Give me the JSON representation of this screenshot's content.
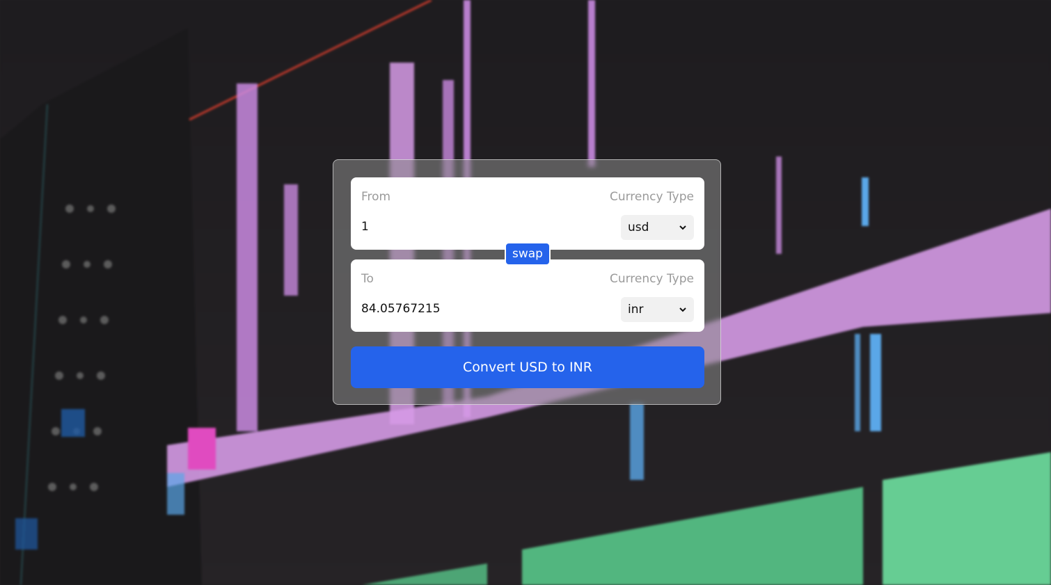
{
  "background": {
    "description_icon": "video-editor-timeline-photo"
  },
  "converter": {
    "from": {
      "label": "From",
      "currency_label": "Currency Type",
      "amount": "1",
      "currency": "usd"
    },
    "swap_label": "swap",
    "to": {
      "label": "To",
      "currency_label": "Currency Type",
      "amount": "84.05767215",
      "currency": "inr"
    },
    "convert_label": "Convert USD to INR"
  },
  "colors": {
    "accent": "#2563eb",
    "card_bg": "#ffffff",
    "muted_text": "#9a9a9a"
  }
}
